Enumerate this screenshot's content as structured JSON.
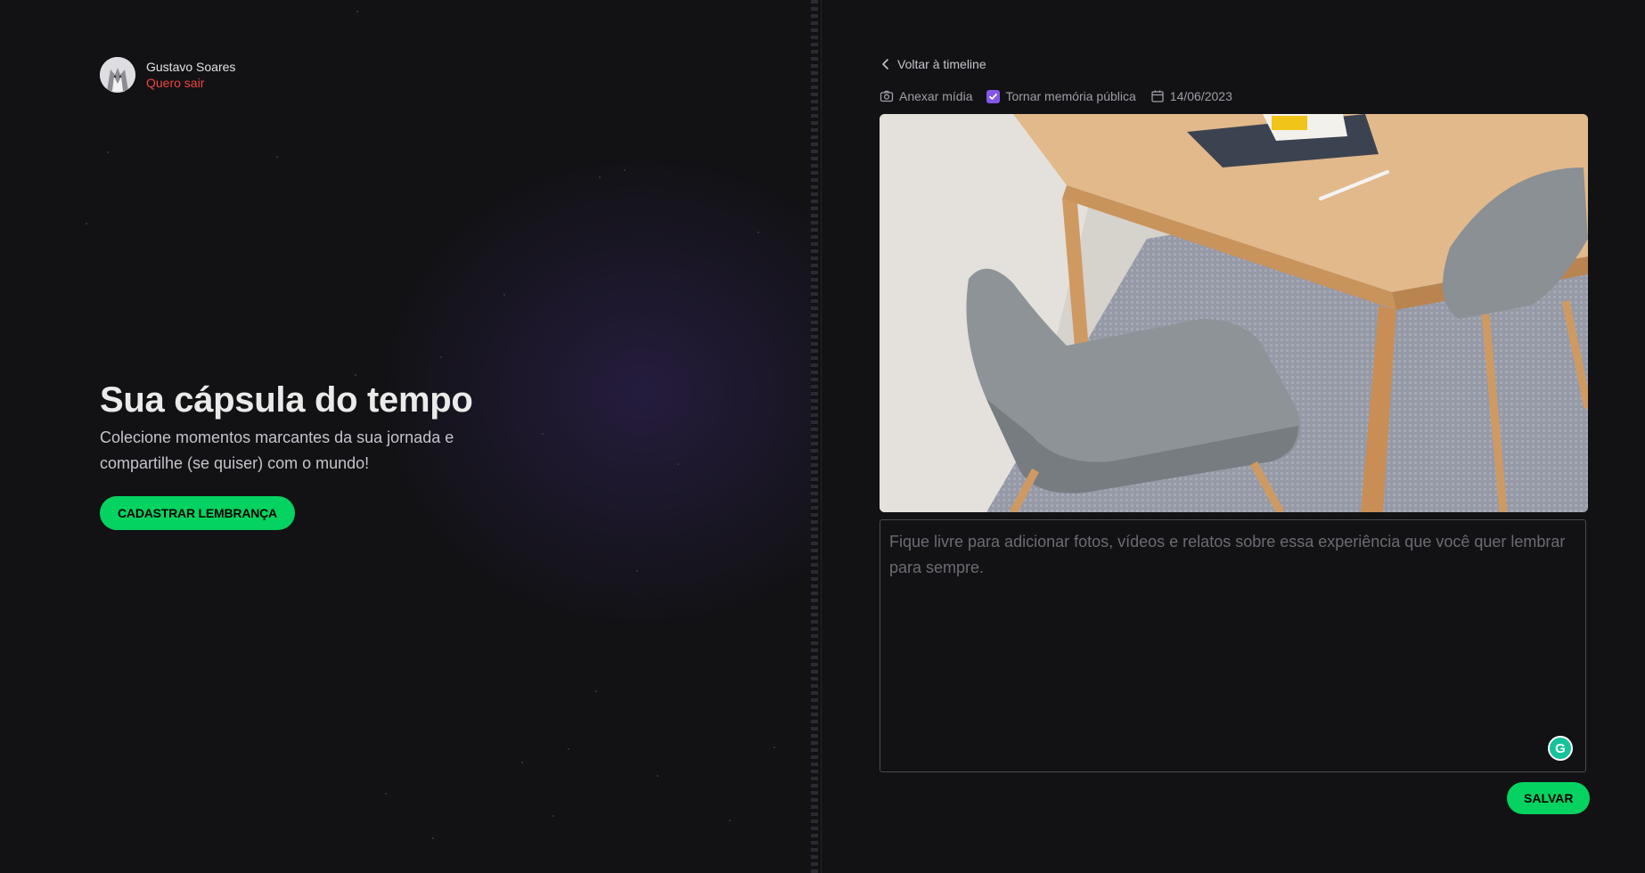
{
  "user": {
    "name": "Gustavo Soares",
    "logout_label": "Quero sair"
  },
  "hero": {
    "title": "Sua cápsula do tempo",
    "description": "Colecione momentos marcantes da sua jornada e compartilhe (se quiser) com o mundo!",
    "cta_label": "CADASTRAR LEMBRANÇA"
  },
  "editor": {
    "back_label": "Voltar à timeline",
    "attach_label": "Anexar mídia",
    "public_label": "Tornar memória pública",
    "public_checked": true,
    "date": "14/06/2023",
    "content_placeholder": "Fique livre para adicionar fotos, vídeos e relatos sobre essa experiência que você quer lembrar para sempre.",
    "save_label": "SALVAR"
  },
  "icons": {
    "back": "chevron-left-icon",
    "attach": "camera-icon",
    "checkbox": "check-icon",
    "date": "calendar-icon",
    "grammarly": "grammarly-icon"
  },
  "colors": {
    "background": "#121215",
    "accent_green": "#04d361",
    "accent_purple": "#8257e5",
    "logout_red": "#ef4444"
  }
}
